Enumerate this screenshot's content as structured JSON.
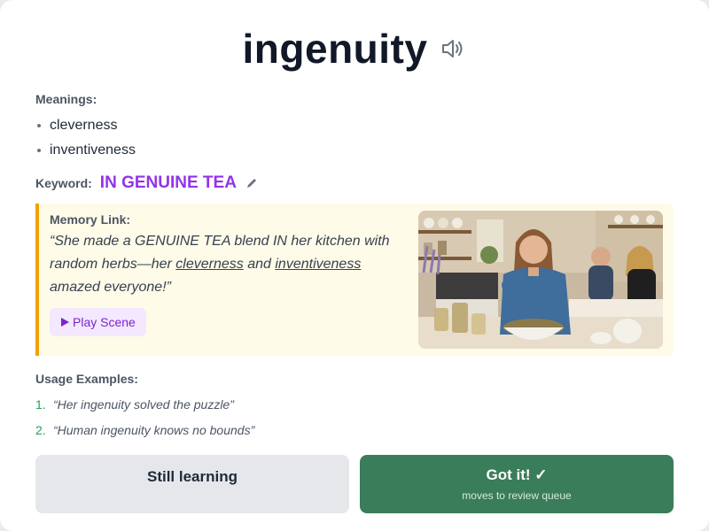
{
  "word": "ingenuity",
  "meanings": {
    "label": "Meanings:",
    "items": [
      "cleverness",
      "inventiveness"
    ]
  },
  "keyword": {
    "label": "Keyword:",
    "value": "IN GENUINE TEA"
  },
  "memory_link": {
    "label": "Memory Link:",
    "quote_parts": {
      "p1": "“She made a GENUINE TEA blend IN her kitchen with random herbs—her ",
      "u1": "cleverness",
      "p2": " and ",
      "u2": "inventiveness",
      "p3": " amazed everyone!”"
    },
    "play_label": "Play Scene",
    "play_icon": "play-triangle"
  },
  "usage": {
    "label": "Usage Examples:",
    "items": [
      {
        "num": "1.",
        "text": "“Her ingenuity solved the puzzle”"
      },
      {
        "num": "2.",
        "text": "“Human ingenuity knows no bounds”"
      }
    ]
  },
  "actions": {
    "still_learning": "Still learning",
    "got_it": "Got it! ✓",
    "got_it_sub": "moves to review queue"
  },
  "colors": {
    "keyword": "#9333ea",
    "accent_border": "#f59e0b",
    "memory_bg": "#fefbe8",
    "got_it_bg": "#3a7d5a",
    "list_number": "#22a05a"
  },
  "icons": [
    "speaker-icon",
    "pencil-icon",
    "play-icon"
  ]
}
